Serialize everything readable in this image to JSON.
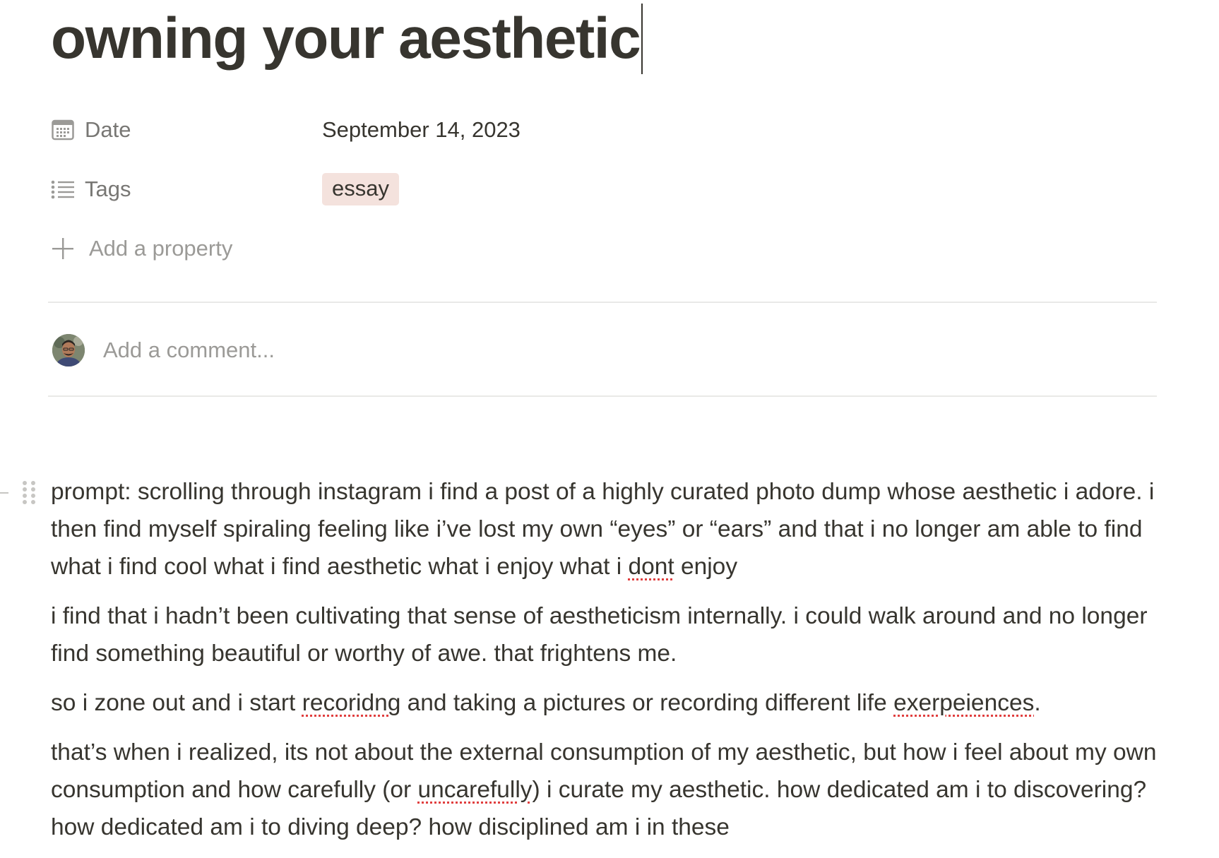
{
  "page": {
    "title": "owning your aesthetic"
  },
  "properties": {
    "date": {
      "icon": "calendar-icon",
      "label": "Date",
      "value": "September 14, 2023"
    },
    "tags": {
      "icon": "list-icon",
      "label": "Tags",
      "value": "essay",
      "tag_color": "#f4e2dd"
    },
    "add_property": {
      "icon": "plus-icon",
      "label": "Add a property"
    }
  },
  "comments": {
    "avatar_icon": "user-avatar",
    "placeholder": "Add a comment..."
  },
  "body": {
    "paragraphs": [
      {
        "segments": [
          {
            "text": "prompt: scrolling through instagram i find a post of a highly curated photo dump whose aesthetic i adore. i then find myself spiraling feeling like i’ve lost my own “eyes” or “ears” and that i no longer am able to find what i find cool what i find aesthetic what i enjoy what i "
          },
          {
            "text": "dont",
            "misspelled": true
          },
          {
            "text": " enjoy"
          }
        ]
      },
      {
        "segments": [
          {
            "text": "i find that i hadn’t been cultivating that sense of aestheticism internally. i could walk around and no longer find something beautiful or worthy of awe. that frightens me."
          }
        ]
      },
      {
        "segments": [
          {
            "text": "so i zone out and i start "
          },
          {
            "text": "recoridng",
            "misspelled": true
          },
          {
            "text": " and taking a pictures or recording different life "
          },
          {
            "text": "exerpeiences",
            "misspelled": true
          },
          {
            "text": "."
          }
        ]
      },
      {
        "segments": [
          {
            "text": "that’s when i realized, its not about the external consumption of my aesthetic, but how i feel about my own consumption and how carefully (or "
          },
          {
            "text": "uncarefully",
            "misspelled": true
          },
          {
            "text": ") i curate my aesthetic. how dedicated am i to discovering? how dedicated am i to diving deep? how disciplined am i in these"
          }
        ]
      }
    ]
  },
  "colors": {
    "text": "#37352f",
    "muted": "#787774",
    "placeholder": "#9b9a97",
    "divider": "#e9e9e7",
    "spellcheck": "#e03e3e"
  }
}
